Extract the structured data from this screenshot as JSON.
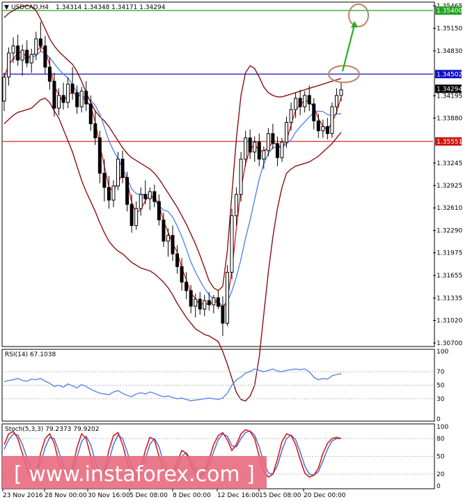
{
  "header": {
    "symbol": "USDCAD,H4",
    "ohlc": "1.34314 1.34348 1.34171 1.34294"
  },
  "watermark": "[ www.instaforex.com ]",
  "colors": {
    "bull_candle": "#000000",
    "bear_candle": "#000000",
    "band": "#8b1010",
    "ma_fast": "#e01818",
    "ma_slow": "#4a7ff0",
    "level_green": "#22a022",
    "level_blue": "#1010c0",
    "level_red": "#d01010",
    "rsi_line": "#5a88e8",
    "stoch_main": "#e01818",
    "stoch_signal": "#3a6ae0",
    "arrow": "#22b022",
    "ellipse": "#c08060",
    "watermark_bg": "#e76a7e"
  },
  "chart_data": [
    {
      "type": "line",
      "title": "USDCAD,H4",
      "price_axis_ticks": [
        "1.35465",
        "1.35150",
        "1.34830",
        "1.34195",
        "1.33880",
        "1.33245",
        "1.32925",
        "1.32610",
        "1.32290",
        "1.31975",
        "1.31655",
        "1.31335",
        "1.31020",
        "1.30700"
      ],
      "ylim": [
        1.3066,
        1.3551
      ],
      "time_axis_labels": [
        "23 Nov 2016",
        "28 Nov 00:00",
        "30 Nov 16:00",
        "5 Dec 08:00",
        "8 Dec 00:00",
        "12 Dec 16:00",
        "15 Dec 08:00",
        "20 Dec 00:00"
      ],
      "levels": [
        {
          "label": "1.35400",
          "value": 1.354,
          "color": "#22a022"
        },
        {
          "label": "1.34502",
          "value": 1.34502,
          "color": "#1010c0"
        },
        {
          "label": "1.35551",
          "value": 1.3355,
          "color": "#d01010"
        }
      ],
      "current_price_label": "1.34294",
      "current_price": 1.34294,
      "candles": [
        [
          1.3412,
          1.3452,
          1.3398,
          1.3446
        ],
        [
          1.3446,
          1.3488,
          1.3434,
          1.348
        ],
        [
          1.348,
          1.3502,
          1.3466,
          1.349
        ],
        [
          1.349,
          1.3506,
          1.3462,
          1.347
        ],
        [
          1.347,
          1.3492,
          1.3448,
          1.3484
        ],
        [
          1.3484,
          1.3498,
          1.346,
          1.3466
        ],
        [
          1.3466,
          1.3486,
          1.3452,
          1.3478
        ],
        [
          1.3478,
          1.351,
          1.347,
          1.35
        ],
        [
          1.35,
          1.3524,
          1.3482,
          1.349
        ],
        [
          1.349,
          1.3504,
          1.345,
          1.346
        ],
        [
          1.346,
          1.3474,
          1.3428,
          1.344
        ],
        [
          1.344,
          1.3452,
          1.339,
          1.3402
        ],
        [
          1.3402,
          1.343,
          1.3392,
          1.342
        ],
        [
          1.342,
          1.3438,
          1.34,
          1.341
        ],
        [
          1.341,
          1.3446,
          1.3402,
          1.3436
        ],
        [
          1.3436,
          1.346,
          1.3414,
          1.3424
        ],
        [
          1.3424,
          1.3434,
          1.3394,
          1.3404
        ],
        [
          1.3404,
          1.3432,
          1.3396,
          1.3426
        ],
        [
          1.3426,
          1.344,
          1.3398,
          1.3408
        ],
        [
          1.3408,
          1.342,
          1.337,
          1.338
        ],
        [
          1.338,
          1.3398,
          1.335,
          1.336
        ],
        [
          1.336,
          1.337,
          1.3296,
          1.331
        ],
        [
          1.331,
          1.333,
          1.327,
          1.329
        ],
        [
          1.329,
          1.3306,
          1.326,
          1.3272
        ],
        [
          1.3272,
          1.33,
          1.3262,
          1.3292
        ],
        [
          1.3292,
          1.334,
          1.3286,
          1.333
        ],
        [
          1.333,
          1.3342,
          1.3296,
          1.3304
        ],
        [
          1.3304,
          1.3312,
          1.3256,
          1.3266
        ],
        [
          1.3266,
          1.328,
          1.3226,
          1.3236
        ],
        [
          1.3236,
          1.327,
          1.323,
          1.326
        ],
        [
          1.326,
          1.329,
          1.325,
          1.328
        ],
        [
          1.328,
          1.33,
          1.3266,
          1.3274
        ],
        [
          1.3274,
          1.329,
          1.3258,
          1.3284
        ],
        [
          1.3284,
          1.3294,
          1.3262,
          1.327
        ],
        [
          1.327,
          1.328,
          1.3236,
          1.3244
        ],
        [
          1.3244,
          1.3254,
          1.3206,
          1.3214
        ],
        [
          1.3214,
          1.3232,
          1.3192,
          1.3222
        ],
        [
          1.3222,
          1.3236,
          1.3186,
          1.3196
        ],
        [
          1.3196,
          1.3208,
          1.3168,
          1.3178
        ],
        [
          1.3178,
          1.319,
          1.3144,
          1.3156
        ],
        [
          1.3156,
          1.317,
          1.3132,
          1.3144
        ],
        [
          1.3144,
          1.3152,
          1.3112,
          1.3122
        ],
        [
          1.3122,
          1.314,
          1.3106,
          1.3132
        ],
        [
          1.3132,
          1.3142,
          1.311,
          1.3118
        ],
        [
          1.3118,
          1.3138,
          1.3108,
          1.313
        ],
        [
          1.313,
          1.3142,
          1.3116,
          1.3124
        ],
        [
          1.3124,
          1.3138,
          1.3112,
          1.3134
        ],
        [
          1.3134,
          1.3144,
          1.3118,
          1.3122
        ],
        [
          1.3122,
          1.3136,
          1.308,
          1.3098
        ],
        [
          1.3098,
          1.318,
          1.3094,
          1.317
        ],
        [
          1.317,
          1.326,
          1.316,
          1.325
        ],
        [
          1.325,
          1.329,
          1.3236,
          1.328
        ],
        [
          1.328,
          1.334,
          1.327,
          1.333
        ],
        [
          1.333,
          1.337,
          1.332,
          1.336
        ],
        [
          1.336,
          1.3372,
          1.333,
          1.334
        ],
        [
          1.334,
          1.3362,
          1.3326,
          1.3354
        ],
        [
          1.3354,
          1.3366,
          1.332,
          1.333
        ],
        [
          1.333,
          1.3348,
          1.3316,
          1.3342
        ],
        [
          1.3342,
          1.3374,
          1.3334,
          1.3366
        ],
        [
          1.3366,
          1.338,
          1.3344,
          1.3352
        ],
        [
          1.3352,
          1.3362,
          1.332,
          1.3332
        ],
        [
          1.3332,
          1.336,
          1.3326,
          1.3354
        ],
        [
          1.3354,
          1.339,
          1.3346,
          1.3382
        ],
        [
          1.3382,
          1.341,
          1.337,
          1.34
        ],
        [
          1.34,
          1.3424,
          1.3388,
          1.3416
        ],
        [
          1.3416,
          1.3428,
          1.3392,
          1.3404
        ],
        [
          1.3404,
          1.3426,
          1.3396,
          1.342
        ],
        [
          1.342,
          1.3434,
          1.3398,
          1.3408
        ],
        [
          1.3408,
          1.3416,
          1.3372,
          1.3384
        ],
        [
          1.3384,
          1.3394,
          1.336,
          1.337
        ],
        [
          1.337,
          1.3386,
          1.336,
          1.3376
        ],
        [
          1.3376,
          1.3388,
          1.3358,
          1.3366
        ],
        [
          1.3366,
          1.341,
          1.336,
          1.3404
        ],
        [
          1.3404,
          1.343,
          1.3394,
          1.342
        ],
        [
          1.342,
          1.3438,
          1.3412,
          1.3428
        ]
      ],
      "upper_band": [
        1.353,
        1.3536,
        1.354,
        1.3544,
        1.3546,
        1.3547,
        1.3546,
        1.354,
        1.3528,
        1.3514,
        1.35,
        1.349,
        1.3482,
        1.3476,
        1.347,
        1.3464,
        1.3454,
        1.344,
        1.3424,
        1.341,
        1.3398,
        1.339,
        1.3384,
        1.3376,
        1.3366,
        1.3356,
        1.3346,
        1.3338,
        1.3332,
        1.3328,
        1.3324,
        1.332,
        1.3316,
        1.331,
        1.3302,
        1.3292,
        1.3282,
        1.3272,
        1.3262,
        1.325,
        1.3238,
        1.3224,
        1.321,
        1.3194,
        1.3176,
        1.3158,
        1.3148,
        1.3144,
        1.315,
        1.32,
        1.328,
        1.336,
        1.342,
        1.3452,
        1.3462,
        1.3458,
        1.3446,
        1.3432,
        1.3424,
        1.342,
        1.3418,
        1.3418,
        1.342,
        1.3422,
        1.3424,
        1.3426,
        1.3428,
        1.343,
        1.3432,
        1.3434,
        1.3436,
        1.3438,
        1.344,
        1.3442,
        1.3444
      ],
      "lower_band": [
        1.338,
        1.3386,
        1.3392,
        1.3396,
        1.3398,
        1.34,
        1.3402,
        1.3408,
        1.3414,
        1.3416,
        1.341,
        1.3398,
        1.3388,
        1.3372,
        1.3356,
        1.334,
        1.332,
        1.33,
        1.3284,
        1.327,
        1.3256,
        1.324,
        1.3226,
        1.3214,
        1.3206,
        1.32,
        1.3196,
        1.319,
        1.3184,
        1.318,
        1.3176,
        1.3174,
        1.3172,
        1.3168,
        1.3162,
        1.3156,
        1.3148,
        1.3138,
        1.3126,
        1.3116,
        1.3106,
        1.3098,
        1.309,
        1.3086,
        1.3082,
        1.308,
        1.3076,
        1.3072,
        1.3058,
        1.304,
        1.302,
        1.3,
        1.299,
        1.2988,
        1.2995,
        1.301,
        1.305,
        1.311,
        1.317,
        1.322,
        1.326,
        1.329,
        1.331,
        1.3316,
        1.332,
        1.3322,
        1.3324,
        1.3326,
        1.333,
        1.3334,
        1.334,
        1.3346,
        1.3352,
        1.336,
        1.3368
      ],
      "rsi": {
        "label": "RSI(14) 67.1038",
        "ticks": [
          "100",
          "70",
          "50",
          "30",
          "0"
        ],
        "ylim": [
          0,
          100
        ],
        "values": [
          55,
          57,
          58,
          60,
          57,
          56,
          59,
          58,
          60,
          56,
          53,
          48,
          50,
          47,
          52,
          49,
          46,
          51,
          48,
          44,
          41,
          38,
          37,
          36,
          40,
          42,
          38,
          35,
          33,
          37,
          39,
          37,
          40,
          38,
          35,
          33,
          34,
          32,
          30,
          31,
          29,
          27,
          28,
          29,
          30,
          31,
          30,
          29,
          31,
          38,
          50,
          58,
          62,
          68,
          70,
          74,
          72,
          70,
          72,
          74,
          71,
          70,
          72,
          73,
          74,
          73,
          74,
          70,
          62,
          58,
          60,
          59,
          64,
          66,
          67
        ]
      },
      "stoch": {
        "label": "Stoch(5,3,3) 79.2373 79.9202",
        "ticks": [
          "100",
          "80",
          "50",
          "20",
          "0"
        ],
        "ylim": [
          0,
          100
        ],
        "main": [
          70,
          88,
          92,
          80,
          55,
          30,
          15,
          20,
          55,
          80,
          88,
          72,
          40,
          20,
          15,
          30,
          65,
          88,
          80,
          50,
          20,
          12,
          25,
          60,
          85,
          90,
          70,
          40,
          18,
          12,
          30,
          60,
          82,
          78,
          50,
          25,
          15,
          20,
          40,
          60,
          55,
          35,
          20,
          15,
          25,
          45,
          70,
          85,
          90,
          78,
          60,
          70,
          88,
          95,
          92,
          80,
          50,
          25,
          15,
          20,
          45,
          75,
          88,
          85,
          70,
          45,
          22,
          15,
          18,
          30,
          55,
          72,
          80,
          82,
          80
        ],
        "signal": [
          62,
          78,
          88,
          86,
          70,
          48,
          28,
          22,
          38,
          65,
          82,
          80,
          58,
          34,
          22,
          26,
          48,
          75,
          84,
          70,
          42,
          22,
          20,
          42,
          70,
          86,
          80,
          58,
          32,
          18,
          22,
          45,
          70,
          80,
          66,
          40,
          22,
          18,
          30,
          50,
          56,
          45,
          28,
          20,
          22,
          36,
          58,
          78,
          88,
          84,
          68,
          66,
          80,
          90,
          93,
          86,
          66,
          40,
          22,
          20,
          34,
          60,
          80,
          86,
          78,
          58,
          34,
          20,
          18,
          24,
          42,
          62,
          76,
          80,
          80
        ]
      }
    }
  ]
}
